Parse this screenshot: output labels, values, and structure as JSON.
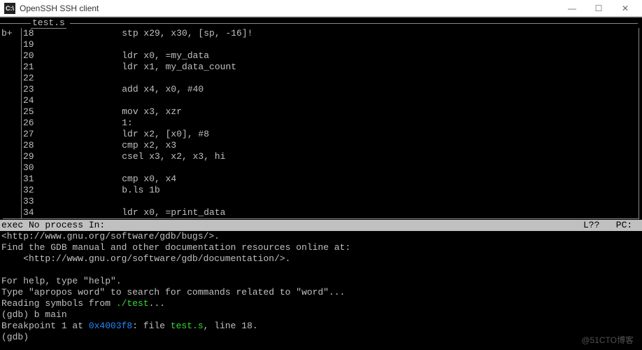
{
  "titlebar": {
    "icon_label": "C:\\",
    "title": "OpenSSH SSH client",
    "min": "—",
    "max": "☐",
    "close": "✕"
  },
  "source": {
    "filename": "test.s",
    "gutter_mark": "b+",
    "lines": [
      {
        "num": "18",
        "text": "              stp x29, x30, [sp, -16]!"
      },
      {
        "num": "19",
        "text": ""
      },
      {
        "num": "20",
        "text": "              ldr x0, =my_data"
      },
      {
        "num": "21",
        "text": "              ldr x1, my_data_count"
      },
      {
        "num": "22",
        "text": ""
      },
      {
        "num": "23",
        "text": "              add x4, x0, #40"
      },
      {
        "num": "24",
        "text": ""
      },
      {
        "num": "25",
        "text": "              mov x3, xzr"
      },
      {
        "num": "26",
        "text": "              1:"
      },
      {
        "num": "27",
        "text": "              ldr x2, [x0], #8"
      },
      {
        "num": "28",
        "text": "              cmp x2, x3"
      },
      {
        "num": "29",
        "text": "              csel x3, x2, x3, hi"
      },
      {
        "num": "30",
        "text": ""
      },
      {
        "num": "31",
        "text": "              cmp x0, x4"
      },
      {
        "num": "32",
        "text": "              b.ls 1b"
      },
      {
        "num": "33",
        "text": ""
      },
      {
        "num": "34",
        "text": "              ldr x0, =print_data"
      }
    ]
  },
  "status": {
    "left": "exec No process In:",
    "right": "L??   PC: "
  },
  "gdb": {
    "l1": "<http://www.gnu.org/software/gdb/bugs/>.",
    "l2": "Find the GDB manual and other documentation resources online at:",
    "l3": "    <http://www.gnu.org/software/gdb/documentation/>.",
    "l4": "",
    "l5": "For help, type \"help\".",
    "l6": "Type \"apropos word\" to search for commands related to \"word\"...",
    "l7_pre": "Reading symbols from ",
    "l7_file": "./test",
    "l7_post": "...",
    "l8": "(gdb) b main",
    "l9_pre": "Breakpoint 1 at ",
    "l9_addr": "0x4003f8",
    "l9_mid": ": file ",
    "l9_file": "test.s",
    "l9_post": ", line 18.",
    "l10": "(gdb) "
  },
  "watermark": "@51CTO博客"
}
